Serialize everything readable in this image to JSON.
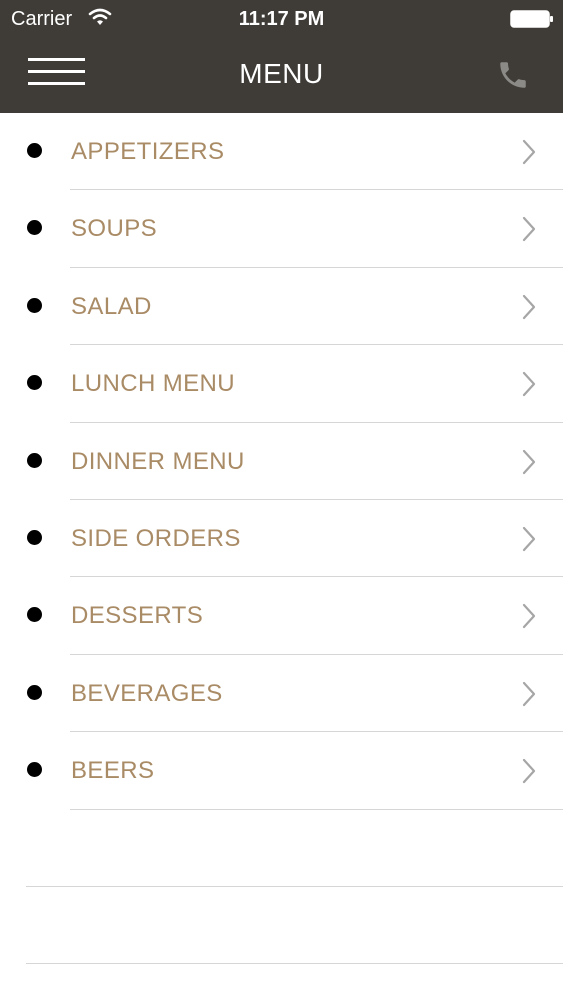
{
  "status_bar": {
    "carrier": "Carrier",
    "time": "11:17 PM",
    "wifi_icon": "wifi-icon",
    "battery_icon": "battery-icon"
  },
  "nav_bar": {
    "title": "MENU",
    "left_icon": "hamburger-icon",
    "right_icon": "phone-icon",
    "background_color": "#3f3c37"
  },
  "menu": {
    "items": [
      {
        "label": "APPETIZERS"
      },
      {
        "label": "SOUPS"
      },
      {
        "label": "SALAD"
      },
      {
        "label": "LUNCH MENU"
      },
      {
        "label": "DINNER MENU"
      },
      {
        "label": "SIDE ORDERS"
      },
      {
        "label": "DESSERTS"
      },
      {
        "label": "BEVERAGES"
      },
      {
        "label": "BEERS"
      }
    ],
    "label_color": "#a98b66",
    "bullet_icon": "bullet-icon",
    "chevron_icon": "chevron-right-icon"
  }
}
